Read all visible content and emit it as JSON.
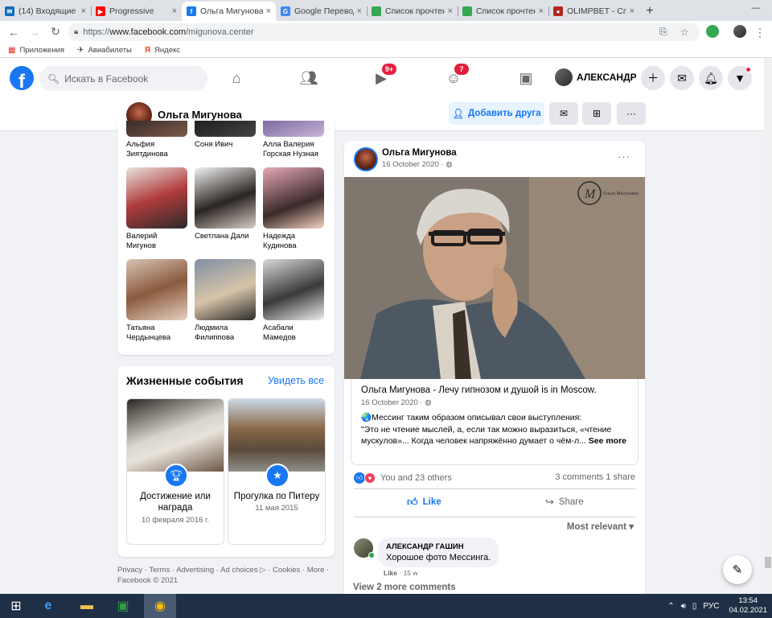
{
  "browser": {
    "tabs": [
      {
        "title": "(14) Входящие -",
        "favicon_color": "#0f6cbd",
        "favicon_glyph": "✉",
        "active": false
      },
      {
        "title": "Progressive ",
        "favicon_color": "#ff0000",
        "favicon_glyph": "▶",
        "active": false
      },
      {
        "title": "Ольга Мигунова",
        "favicon_color": "#1877f2",
        "favicon_glyph": "f",
        "active": true
      },
      {
        "title": "Google Переводч",
        "favicon_color": "#4285f4",
        "favicon_glyph": "G",
        "active": false
      },
      {
        "title": "Список прочтени",
        "favicon_color": "#34a853",
        "favicon_glyph": "",
        "active": false
      },
      {
        "title": "Список прочтени",
        "favicon_color": "#34a853",
        "favicon_glyph": "",
        "active": false
      },
      {
        "title": "OLIMPBET - Спо",
        "favicon_color": "#b3261e",
        "favicon_glyph": "●",
        "active": false
      }
    ],
    "url_scheme": "https://",
    "url_host": "www.facebook.com",
    "url_path": "/migunova.center",
    "bookmarks": [
      {
        "label": "Приложения",
        "icon": "apps-grid-icon"
      },
      {
        "label": "Авиабилеты",
        "icon": "plane-icon"
      },
      {
        "label": "Яндекс",
        "icon": "yandex-icon"
      }
    ]
  },
  "facebook": {
    "brand_color": "#1877f2",
    "search_placeholder": "Искать в Facebook",
    "watch_badge": "9+",
    "groups_badge": "7",
    "user_name": "АЛЕКСАНДР"
  },
  "profile": {
    "name": "Ольга Мигунова",
    "add_friend": "Добавить друга"
  },
  "friends": [
    {
      "name": "Альфия Зиятдинова"
    },
    {
      "name": "Соня Ивич"
    },
    {
      "name": "Алла Валерия Горская Нузная"
    },
    {
      "name": "Валерий Мигунов"
    },
    {
      "name": "Светлана Дали"
    },
    {
      "name": "Надежда Кудинова"
    },
    {
      "name": "Татьяна Чердынцева"
    },
    {
      "name": "Людмила Филиппова"
    },
    {
      "name": "Асабали Мамедов"
    }
  ],
  "life_events": {
    "title": "Жизненные события",
    "see_all": "Увидеть все",
    "items": [
      {
        "title": "Достижение или награда",
        "date": "10 февраля 2016 г.",
        "icon": "trophy-icon"
      },
      {
        "title": "Прогулка по Питеру",
        "date": "11 мая 2015",
        "icon": "star-icon"
      }
    ]
  },
  "footer": {
    "links": "Privacy · Terms · Advertising · Ad choices ▷ · Cookies · More ·",
    "copyright": "Facebook © 2021"
  },
  "post": {
    "author": "Ольга Мигунова",
    "date": "16 October 2020 ·",
    "shared": {
      "title_prefix": "Ольга Мигунова - Лечу гипнозом и душой",
      "title_suffix": "is in",
      "title_place": "Moscow.",
      "date": "16 October 2020 ·",
      "body_line1": "🌏Мессинг таким образом описывал свои выступления:",
      "body_line2": "\"Это не чтение мыслей, а, если так можно выразиться, «чтение мускулов»... Когда человек напряжённо думает о чём-л...",
      "see_more": "See more"
    },
    "reactions_text": "You and 23 others",
    "comments_shares": "3 comments  1 share",
    "like_label": "Like",
    "share_label": "Share",
    "sort_label": "Most relevant",
    "comment": {
      "author": "АЛЕКСАНДР ГАШИН",
      "text": "Хорошое фото Мессинга.",
      "like": "Like",
      "age": "· 15 w"
    },
    "view_more": "View 2 more comments"
  },
  "taskbar": {
    "lang": "РУС",
    "time": "13:54",
    "date": "04.02.2021"
  }
}
